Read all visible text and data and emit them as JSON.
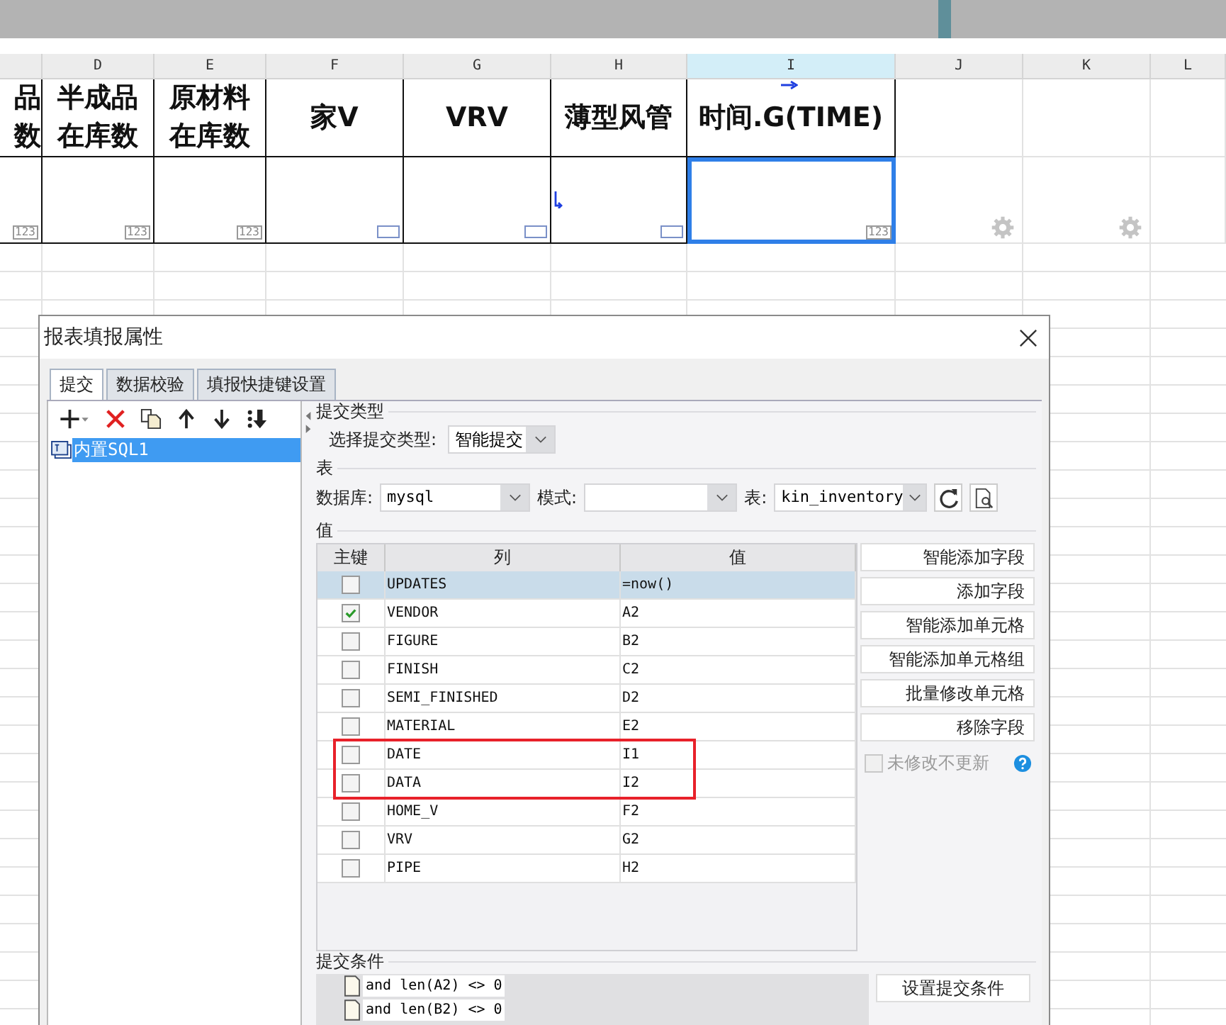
{
  "sheet": {
    "columns": [
      {
        "selected": false
      },
      {
        "label": "D",
        "selected": false
      },
      {
        "label": "E",
        "selected": false
      },
      {
        "label": "F",
        "selected": false
      },
      {
        "label": "G",
        "selected": false
      },
      {
        "label": "H",
        "selected": false
      },
      {
        "label": "I",
        "selected": true
      },
      {
        "label": "J",
        "selected": false
      },
      {
        "label": "K",
        "selected": false
      },
      {
        "label": "L",
        "selected": false
      }
    ],
    "header_row": [
      {
        "lines": [
          "品",
          "数"
        ],
        "expand": false
      },
      {
        "lines": [
          "半成品",
          "在库数"
        ],
        "expand": false
      },
      {
        "lines": [
          "原材料",
          "在库数"
        ],
        "expand": false
      },
      {
        "lines": [
          "家V"
        ],
        "expand": false
      },
      {
        "lines": [
          "VRV"
        ],
        "expand": false
      },
      {
        "lines": [
          "薄型风管"
        ],
        "expand": false
      },
      {
        "lines": [
          "时间.G(TIME)"
        ],
        "expand": true
      },
      {
        "expand": false
      },
      {
        "expand": false
      },
      {
        "expand": false
      }
    ],
    "data_row": [
      {
        "kind": "number",
        "badge": "123",
        "expand": false
      },
      {
        "kind": "number",
        "badge": "123",
        "expand": false
      },
      {
        "kind": "number",
        "badge": "123",
        "expand": false
      },
      {
        "kind": "text",
        "expand": false
      },
      {
        "kind": "text",
        "expand": false
      },
      {
        "kind": "text",
        "expand": true
      },
      {
        "kind": "number",
        "badge": "123",
        "expand": false
      },
      {
        "kind": "gear",
        "expand": false
      },
      {
        "kind": "gear",
        "expand": false
      },
      {
        "kind": "none",
        "expand": false
      }
    ]
  },
  "dialog": {
    "title": "报表填报属性",
    "tabs": [
      {
        "label": "提交",
        "selected": true
      },
      {
        "label": "数据校验",
        "selected": false
      },
      {
        "label": "填报快捷键设置",
        "selected": false
      }
    ],
    "tree": [
      {
        "label": "内置SQL1",
        "selected": true
      }
    ],
    "submit_type": {
      "label": "提交类型",
      "field_label": "选择提交类型:",
      "value": "智能提交"
    },
    "table_section": {
      "label": "表",
      "database_label": "数据库:",
      "database": "mysql",
      "schema_label": "模式:",
      "table_label": "表:",
      "table": "kin_inventory"
    },
    "values": {
      "label": "值",
      "columns": [
        "主键",
        "列",
        "值"
      ],
      "rows": [
        {
          "key": false,
          "column": "UPDATES",
          "value": "=now()",
          "selected": true,
          "highlighted": false
        },
        {
          "key": true,
          "column": "VENDOR",
          "value": "A2",
          "selected": false,
          "highlighted": false
        },
        {
          "key": false,
          "column": "FIGURE",
          "value": "B2",
          "selected": false,
          "highlighted": false
        },
        {
          "key": false,
          "column": "FINISH",
          "value": "C2",
          "selected": false,
          "highlighted": false
        },
        {
          "key": false,
          "column": "SEMI_FINISHED",
          "value": "D2",
          "selected": false,
          "highlighted": false
        },
        {
          "key": false,
          "column": "MATERIAL",
          "value": "E2",
          "selected": false,
          "highlighted": false
        },
        {
          "key": false,
          "column": "DATE",
          "value": "I1",
          "selected": false,
          "highlighted": true
        },
        {
          "key": false,
          "column": "DATA",
          "value": "I2",
          "selected": false,
          "highlighted": true
        },
        {
          "key": false,
          "column": "HOME_V",
          "value": "F2",
          "selected": false,
          "highlighted": false
        },
        {
          "key": false,
          "column": "VRV",
          "value": "G2",
          "selected": false,
          "highlighted": false
        },
        {
          "key": false,
          "column": "PIPE",
          "value": "H2",
          "selected": false,
          "highlighted": false
        }
      ],
      "buttons": [
        "智能添加字段",
        "添加字段",
        "智能添加单元格",
        "智能添加单元格组",
        "批量修改单元格",
        "移除字段"
      ],
      "option": {
        "label": "未修改不更新",
        "checked": false,
        "disabled": true
      }
    },
    "conditions": {
      "label": "提交条件",
      "items": [
        "and len(A2) <> 0",
        "and len(B2) <> 0"
      ],
      "button": "设置提交条件"
    }
  }
}
